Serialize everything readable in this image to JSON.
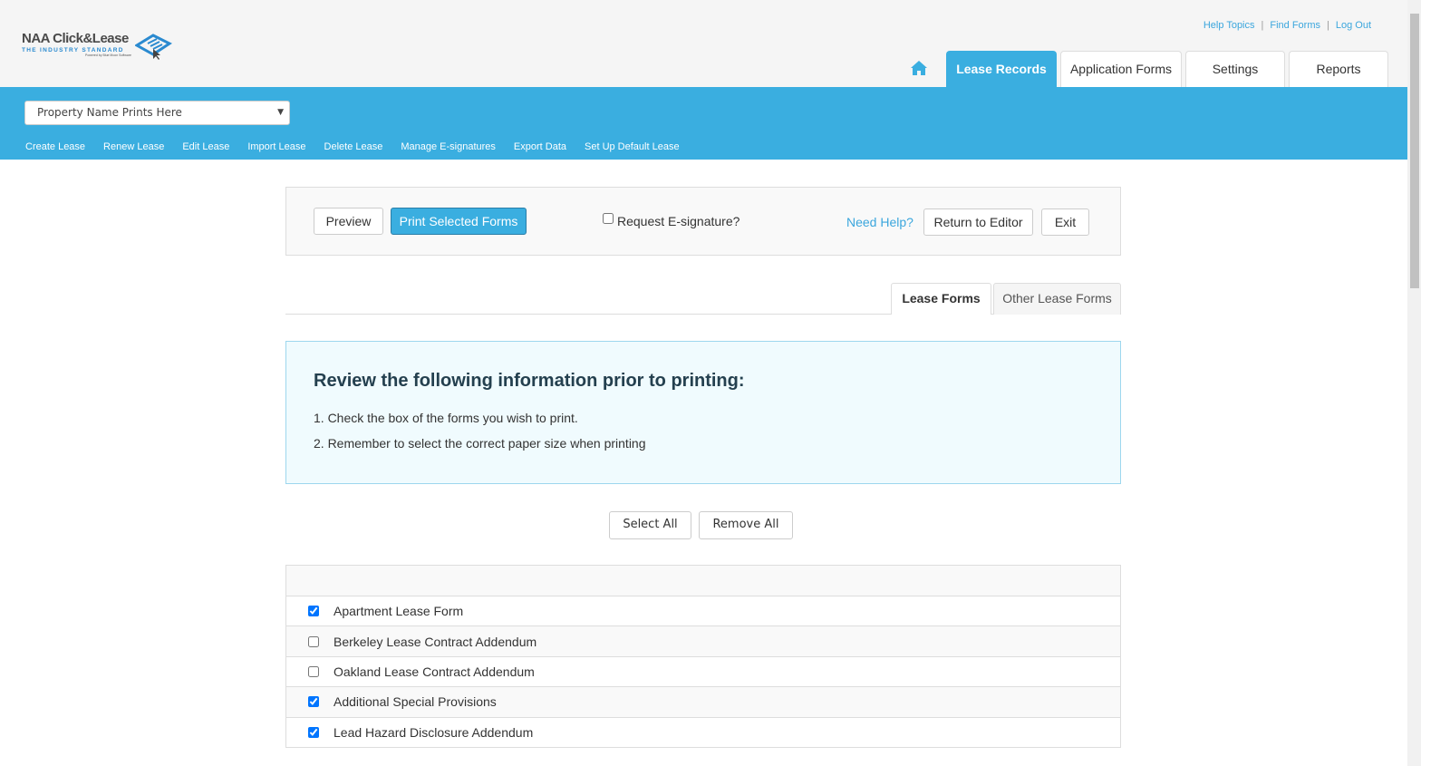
{
  "header": {
    "logo": {
      "name": "NAA Click&Lease",
      "tagline": "THE INDUSTRY STANDARD",
      "powered": "Powered by Blue Moon Software"
    },
    "top_links": [
      "Help Topics",
      "Find Forms",
      "Log Out"
    ],
    "tabs": [
      {
        "label": "Lease Records",
        "active": true
      },
      {
        "label": "Application Forms"
      },
      {
        "label": "Settings"
      },
      {
        "label": "Reports"
      }
    ],
    "home_icon": "home-icon"
  },
  "property_select": {
    "value": "Property Name Prints Here"
  },
  "subnav": [
    "Create Lease",
    "Renew Lease",
    "Edit Lease",
    "Import Lease",
    "Delete Lease",
    "Manage E-signatures",
    "Export Data",
    "Set Up Default Lease"
  ],
  "toolbar": {
    "preview": "Preview",
    "print": "Print Selected Forms",
    "esignature": "Request E-signature?",
    "esignature_checked": false,
    "need_help": "Need Help?",
    "return": "Return to Editor",
    "exit": "Exit"
  },
  "form_tabs": [
    {
      "label": "Lease Forms",
      "active": true
    },
    {
      "label": "Other Lease Forms"
    }
  ],
  "info": {
    "title": "Review the following information prior to printing:",
    "items": [
      "1. Check the box of the forms you wish to print.",
      "2. Remember to select the correct paper size when printing"
    ]
  },
  "actions": {
    "select_all": "Select All",
    "remove_all": "Remove All"
  },
  "forms": [
    {
      "label": "Apartment Lease Form",
      "checked": true
    },
    {
      "label": "Berkeley Lease Contract Addendum",
      "checked": false
    },
    {
      "label": "Oakland Lease Contract Addendum",
      "checked": false
    },
    {
      "label": "Additional Special Provisions",
      "checked": true
    },
    {
      "label": "Lead Hazard Disclosure Addendum",
      "checked": true
    }
  ],
  "colors": {
    "accent": "#3aaee0",
    "link": "#3ba6dd"
  }
}
